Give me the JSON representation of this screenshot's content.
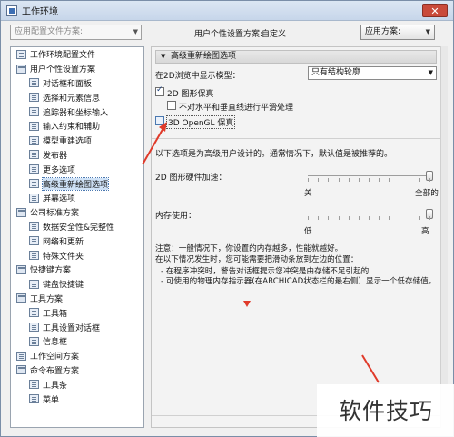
{
  "window": {
    "title": "工作环境",
    "close_glyph": "✕"
  },
  "toolbar": {
    "preset_placeholder": "应用配置文件方案:",
    "profile_label": "用户个性设置方案:",
    "profile_name": "自定义",
    "apply_label": "应用方案:"
  },
  "tree": [
    {
      "label": "工作环境配置文件",
      "level": 0,
      "icon": "profile-icon"
    },
    {
      "label": "用户个性设置方案",
      "level": 0,
      "icon": "folder-icon"
    },
    {
      "label": "对话框和面板",
      "level": 1,
      "icon": "page-icon"
    },
    {
      "label": "选择和元素信息",
      "level": 1,
      "icon": "page-icon"
    },
    {
      "label": "追踪器和坐标输入",
      "level": 1,
      "icon": "page-icon"
    },
    {
      "label": "输入约束和辅助",
      "level": 1,
      "icon": "page-icon"
    },
    {
      "label": "模型重建选项",
      "level": 1,
      "icon": "page-icon"
    },
    {
      "label": "发布器",
      "level": 1,
      "icon": "page-icon"
    },
    {
      "label": "更多选项",
      "level": 1,
      "icon": "page-icon"
    },
    {
      "label": "高级重新绘图选项",
      "level": 1,
      "icon": "page-icon",
      "selected": true
    },
    {
      "label": "屏幕选项",
      "level": 1,
      "icon": "page-icon"
    },
    {
      "label": "公司标准方案",
      "level": 0,
      "icon": "folder-icon"
    },
    {
      "label": "数据安全性&完整性",
      "level": 1,
      "icon": "page-icon"
    },
    {
      "label": "网络和更新",
      "level": 1,
      "icon": "page-icon"
    },
    {
      "label": "特殊文件夹",
      "level": 1,
      "icon": "page-icon"
    },
    {
      "label": "快捷键方案",
      "level": 0,
      "icon": "folder-icon"
    },
    {
      "label": "键盘快捷键",
      "level": 1,
      "icon": "page-icon"
    },
    {
      "label": "工具方案",
      "level": 0,
      "icon": "folder-icon"
    },
    {
      "label": "工具箱",
      "level": 1,
      "icon": "page-icon"
    },
    {
      "label": "工具设置对话框",
      "level": 1,
      "icon": "page-icon"
    },
    {
      "label": "信息框",
      "level": 1,
      "icon": "page-icon"
    },
    {
      "label": "工作空间方案",
      "level": 0,
      "icon": "page-icon"
    },
    {
      "label": "命令布置方案",
      "level": 0,
      "icon": "folder-icon"
    },
    {
      "label": "工具条",
      "level": 1,
      "icon": "page-icon"
    },
    {
      "label": "菜单",
      "level": 1,
      "icon": "page-icon"
    }
  ],
  "panel": {
    "section_title": "高级重新绘图选项",
    "model_label": "在2D浏览中显示模型：",
    "model_value": "只有结构轮廓",
    "opt_2d_smooth": {
      "label": "2D 图形保真",
      "checked": true
    },
    "opt_no_smooth": {
      "label": "不对水平和垂直线进行平滑处理",
      "checked": false
    },
    "opt_3d_opengl": {
      "label": "3D OpenGL 保真",
      "checked": false
    },
    "advanced_note": "以下选项是为高级用户设计的。通常情况下，默认值是被推荐的。",
    "hw_accel_label": "2D 图形硬件加速：",
    "hw_min": "关",
    "hw_max": "全部的",
    "hw_level": 1.0,
    "memory_label": "内存使用：",
    "mem_min": "低",
    "mem_max": "高",
    "mem_level": 1.0,
    "caution_1": "注意：一般情况下，你设置的内存越多，性能就越好。",
    "caution_2": "在以下情况发生时，您可能需要把滑动条放到左边的位置：",
    "caution_3": "- 在程序冲突时，警告对话框提示您冲突是由存储不足引起的",
    "caution_4": "- 可使用的物理内存指示器(在ARCHICAD状态栏的最右侧）显示一个低存储值。"
  },
  "watermark": "软件技巧",
  "colors": {
    "accent_red": "#e03a2a",
    "selection": "#cfe2f7"
  }
}
